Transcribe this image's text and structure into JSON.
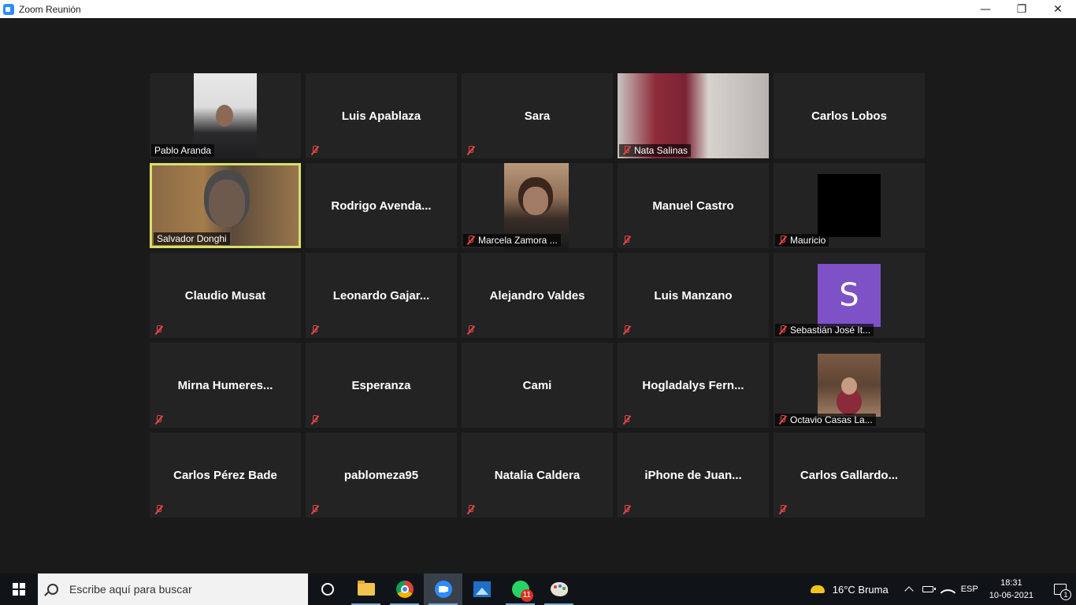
{
  "window": {
    "title": "Zoom Reunión"
  },
  "participants": [
    {
      "name": "Pablo Aranda",
      "video": true,
      "muted": false
    },
    {
      "name": "Luis Apablaza",
      "video": false,
      "muted": true
    },
    {
      "name": "Sara",
      "video": false,
      "muted": true
    },
    {
      "name": "Nata Salinas",
      "video": true,
      "muted": true
    },
    {
      "name": "Carlos Lobos",
      "video": false,
      "muted": false
    },
    {
      "name": "Salvador Donghi",
      "video": true,
      "muted": false,
      "speaking": true
    },
    {
      "name": "Rodrigo  Avenda...",
      "video": false,
      "muted": false
    },
    {
      "name": "Marcela Zamora ...",
      "video": true,
      "muted": true
    },
    {
      "name": "Manuel Castro",
      "video": false,
      "muted": true
    },
    {
      "name": "Mauricio",
      "video": true,
      "muted": true
    },
    {
      "name": "Claudio Musat",
      "video": false,
      "muted": true
    },
    {
      "name": "Leonardo  Gajar...",
      "video": false,
      "muted": true
    },
    {
      "name": "Alejandro Valdes",
      "video": false,
      "muted": true
    },
    {
      "name": "Luis Manzano",
      "video": false,
      "muted": true
    },
    {
      "name": "Sebastián José It...",
      "video": true,
      "muted": true,
      "avatar_letter": "S"
    },
    {
      "name": "Mirna  Humeres...",
      "video": false,
      "muted": true
    },
    {
      "name": "Esperanza",
      "video": false,
      "muted": true
    },
    {
      "name": "Cami",
      "video": false,
      "muted": false
    },
    {
      "name": "Hogladalys  Fern...",
      "video": false,
      "muted": true
    },
    {
      "name": "Octavio Casas La...",
      "video": true,
      "muted": true
    },
    {
      "name": "Carlos Pérez Bade",
      "video": false,
      "muted": true
    },
    {
      "name": "pablomeza95",
      "video": false,
      "muted": true
    },
    {
      "name": "Natalia Caldera",
      "video": false,
      "muted": true
    },
    {
      "name": "iPhone  de  Juan...",
      "video": false,
      "muted": true
    },
    {
      "name": "Carlos  Gallardo...",
      "video": false,
      "muted": true
    }
  ],
  "taskbar": {
    "search_placeholder": "Escribe aquí para buscar",
    "whatsapp_badge": "11",
    "weather": "16°C  Bruma",
    "language": "ESP",
    "time": "18:31",
    "date": "10-06-2021",
    "notification_count": "1"
  },
  "colors": {
    "active_speaker": "#d8e06a",
    "muted_icon": "#e84545",
    "tile_bg": "#232323",
    "accent": "#2d8cff"
  }
}
